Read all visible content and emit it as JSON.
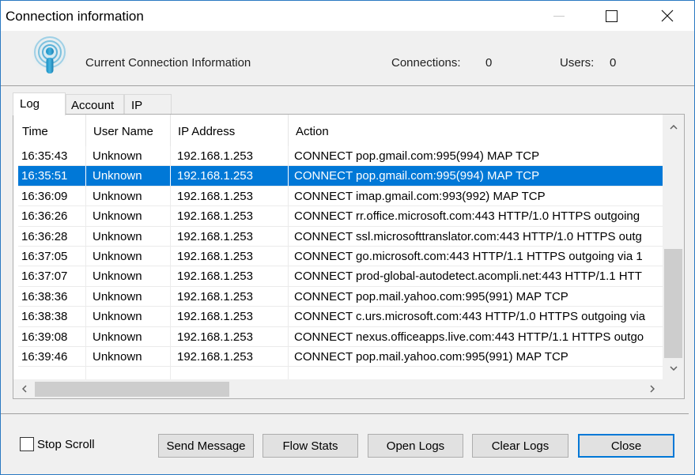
{
  "window": {
    "title": "Connection information",
    "controls": {
      "minimize": "minimize-icon",
      "maximize": "maximize-icon",
      "close": "close-icon"
    }
  },
  "header": {
    "icon": "broadcast-info-icon",
    "title": "Current Connection Information",
    "connections_label": "Connections:",
    "connections_value": "0",
    "users_label": "Users:",
    "users_value": "0"
  },
  "tabs": [
    {
      "label": "Log",
      "active": true
    },
    {
      "label": "Account",
      "active": false
    },
    {
      "label": "IP",
      "active": false
    }
  ],
  "log_table": {
    "columns": [
      "Time",
      "User Name",
      "IP Address",
      "Action"
    ],
    "selected_index": 1,
    "rows": [
      {
        "time": "16:35:43",
        "user": "Unknown",
        "ip": "192.168.1.253",
        "action": "CONNECT pop.gmail.com:995(994) MAP TCP"
      },
      {
        "time": "16:35:51",
        "user": "Unknown",
        "ip": "192.168.1.253",
        "action": "CONNECT pop.gmail.com:995(994) MAP TCP"
      },
      {
        "time": "16:36:09",
        "user": "Unknown",
        "ip": "192.168.1.253",
        "action": "CONNECT imap.gmail.com:993(992) MAP TCP"
      },
      {
        "time": "16:36:26",
        "user": "Unknown",
        "ip": "192.168.1.253",
        "action": "CONNECT rr.office.microsoft.com:443 HTTP/1.0 HTTPS outgoing"
      },
      {
        "time": "16:36:28",
        "user": "Unknown",
        "ip": "192.168.1.253",
        "action": "CONNECT ssl.microsofttranslator.com:443 HTTP/1.0 HTTPS outg"
      },
      {
        "time": "16:37:05",
        "user": "Unknown",
        "ip": "192.168.1.253",
        "action": "CONNECT go.microsoft.com:443 HTTP/1.1 HTTPS outgoing via 1"
      },
      {
        "time": "16:37:07",
        "user": "Unknown",
        "ip": "192.168.1.253",
        "action": "CONNECT prod-global-autodetect.acompli.net:443 HTTP/1.1 HTT"
      },
      {
        "time": "16:38:36",
        "user": "Unknown",
        "ip": "192.168.1.253",
        "action": "CONNECT pop.mail.yahoo.com:995(991) MAP TCP"
      },
      {
        "time": "16:38:38",
        "user": "Unknown",
        "ip": "192.168.1.253",
        "action": "CONNECT c.urs.microsoft.com:443 HTTP/1.0 HTTPS outgoing via"
      },
      {
        "time": "16:39:08",
        "user": "Unknown",
        "ip": "192.168.1.253",
        "action": "CONNECT nexus.officeapps.live.com:443 HTTP/1.1 HTTPS outgo"
      },
      {
        "time": "16:39:46",
        "user": "Unknown",
        "ip": "192.168.1.253",
        "action": "CONNECT pop.mail.yahoo.com:995(991) MAP TCP"
      }
    ],
    "scroll_arrows": {
      "up": "^",
      "down": "v",
      "left": "<",
      "right": ">"
    }
  },
  "footer": {
    "stop_scroll_label": "Stop Scroll",
    "stop_scroll_checked": false,
    "buttons": {
      "send_message": "Send Message",
      "flow_stats": "Flow Stats",
      "open_logs": "Open Logs",
      "clear_logs": "Clear Logs",
      "close": "Close"
    }
  },
  "colors": {
    "selection": "#0078d7",
    "window_border": "#2b79c2",
    "default_button_border": "#0078d7"
  }
}
